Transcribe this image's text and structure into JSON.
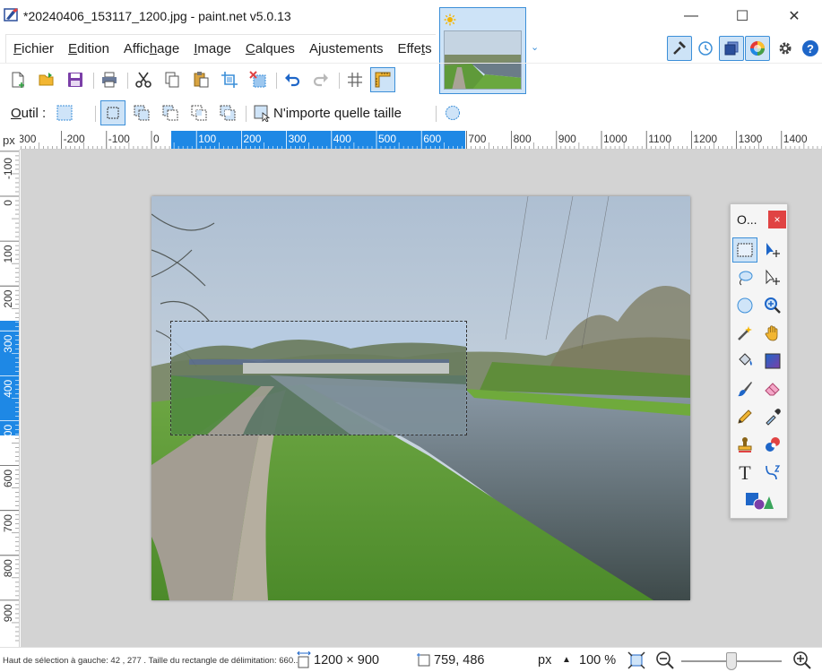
{
  "window": {
    "title": "*20240406_153117_1200.jpg - paint.net v5.0.13",
    "minimize": "—",
    "maximize": "☐",
    "close": "✕"
  },
  "menu": {
    "items": [
      {
        "label": "Fichier",
        "accel": "F",
        "rest": "ichier"
      },
      {
        "label": "Edition",
        "accel": "E",
        "rest": "dition"
      },
      {
        "pre": "Affic",
        "accel": "h",
        "rest": "age",
        "label": "Affichage"
      },
      {
        "label": "Image",
        "accel": "I",
        "rest": "mage"
      },
      {
        "label": "Calques",
        "accel": "C",
        "rest": "alques"
      },
      {
        "pre": "A",
        "accel": "j",
        "rest": "ustements",
        "label": "Ajustements"
      },
      {
        "pre": "Effe",
        "accel": "t",
        "rest": "s",
        "label": "Effets"
      }
    ]
  },
  "options_bar": {
    "tool_label_accel": "O",
    "tool_label_rest": "util :",
    "selection_size_mode": "N'importe quelle taille"
  },
  "ruler": {
    "unit": "px",
    "h_labels": [
      "300",
      "-200",
      "-100",
      "0",
      "100",
      "200",
      "300",
      "400",
      "500",
      "600",
      "700",
      "800",
      "900",
      "1000",
      "1100",
      "1200",
      "1300",
      "1400"
    ],
    "v_labels": [
      "-100",
      "0",
      "100",
      "200",
      "300",
      "400",
      "500",
      "600",
      "700",
      "800",
      "900"
    ]
  },
  "tools_window": {
    "title": "O...",
    "close": "×"
  },
  "status": {
    "hint": "Haut de sélection à gauche: 42 , 277 . Taille du rectangle de délimitation: 660...",
    "image_size": "1200 × 900",
    "cursor_position": "759, 486",
    "units": "px",
    "zoom": "100 %"
  },
  "colors": {
    "accent": "#1e88e5",
    "active_bg": "#cde3f7",
    "active_border": "#3c8fd8",
    "workspace": "#d3d3d3",
    "close_red": "#e04343"
  }
}
